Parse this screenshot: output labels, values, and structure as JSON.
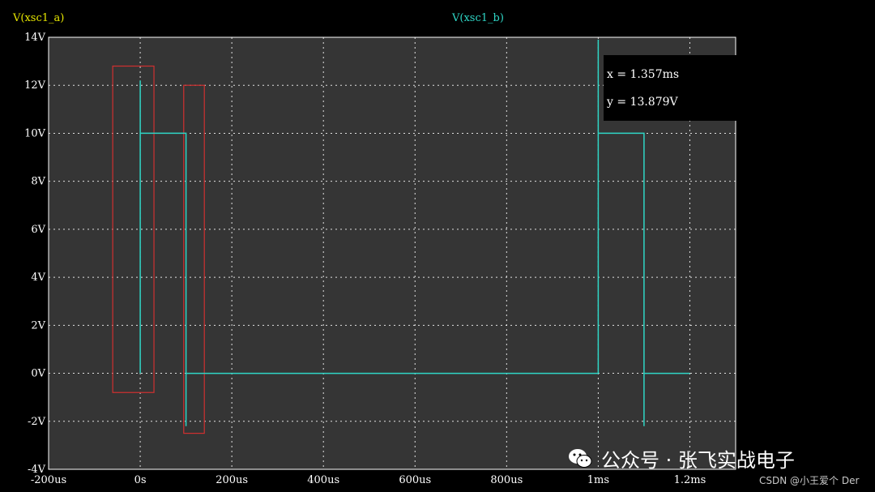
{
  "series_labels": {
    "a": "V(xsc1_a)",
    "b": "V(xsc1_b)"
  },
  "colors": {
    "series_a_label": "#e6e600",
    "series_b": "#2fd6c6",
    "plot_bg": "#353535",
    "grid": "#ffffff",
    "highlight_box": "#d03030",
    "tick_text": "#ffffff"
  },
  "cursor_readout": {
    "x": "x = 1.357ms",
    "y": "y = 13.879V"
  },
  "watermark": {
    "wechat": "公众号 · 张飞实战电子",
    "csdn": "CSDN @小王爱个 Der",
    "icon": "wechat-icon"
  },
  "chart_data": {
    "type": "line",
    "x_unit": "us",
    "y_unit": "V",
    "xlim": [
      -200,
      1300
    ],
    "ylim": [
      -4,
      14
    ],
    "x_ticks": [
      {
        "value": -200,
        "label": "-200us"
      },
      {
        "value": 0,
        "label": "0s"
      },
      {
        "value": 200,
        "label": "200us"
      },
      {
        "value": 400,
        "label": "400us"
      },
      {
        "value": 600,
        "label": "600us"
      },
      {
        "value": 800,
        "label": "800us"
      },
      {
        "value": 1000,
        "label": "1ms"
      },
      {
        "value": 1200,
        "label": "1.2ms"
      }
    ],
    "y_ticks": [
      {
        "value": 14,
        "label": "14V"
      },
      {
        "value": 12,
        "label": "12V"
      },
      {
        "value": 10,
        "label": "10V"
      },
      {
        "value": 8,
        "label": "8V"
      },
      {
        "value": 6,
        "label": "6V"
      },
      {
        "value": 4,
        "label": "4V"
      },
      {
        "value": 2,
        "label": "2V"
      },
      {
        "value": 0,
        "label": "0V"
      },
      {
        "value": -2,
        "label": "-2V"
      },
      {
        "value": -4,
        "label": "-4V"
      }
    ],
    "grid": true,
    "series": [
      {
        "name": "V(xsc1_b)",
        "x": [
          0,
          0,
          0,
          0,
          100,
          100,
          100,
          100,
          1000,
          1000,
          1000,
          1000,
          1100,
          1100,
          1100,
          1100,
          1200
        ],
        "y": [
          0,
          12.2,
          10,
          10,
          10,
          -2.2,
          0,
          0,
          0,
          13.9,
          10,
          10,
          10,
          -2.2,
          0,
          0,
          0
        ]
      }
    ],
    "highlight_boxes": [
      {
        "x0": -60,
        "x1": 30,
        "y0": -0.8,
        "y1": 12.8
      },
      {
        "x0": 95,
        "x1": 140,
        "y0": -2.5,
        "y1": 12.0
      }
    ]
  }
}
